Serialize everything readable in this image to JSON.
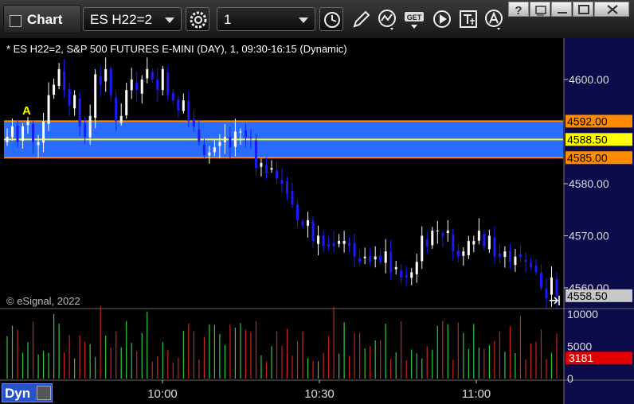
{
  "window": {
    "tab_label": "Chart",
    "symbol": "ES H22=2",
    "interval": "1",
    "toolbar_icons": [
      "settings-icon",
      "clock-icon",
      "pencil-icon",
      "indicator-icon",
      "get-icon",
      "play-icon",
      "text-icon",
      "alert-icon"
    ],
    "window_controls": [
      "help-icon",
      "restore-icon",
      "maximize-icon",
      "close-icon"
    ]
  },
  "chart_title": "* ES H22=2, S&P 500 FUTURES E-MINI (DAY), 1, 09:30-16:15 (Dynamic)",
  "copyright": "© eSignal, 2022",
  "marker_label": "A",
  "price_axis": {
    "labels": [
      "4600.00",
      "4580.00",
      "4570.00",
      "4560.00"
    ],
    "tags": [
      {
        "text": "4592.00",
        "price": 4592.0,
        "bg": "#ff8c00",
        "fg": "#000000"
      },
      {
        "text": "4588.50",
        "price": 4588.5,
        "bg": "#ffff00",
        "fg": "#000000"
      },
      {
        "text": "4585.00",
        "price": 4585.0,
        "bg": "#ff8c00",
        "fg": "#000000"
      },
      {
        "text": "4558.50",
        "price": 4558.5,
        "bg": "#c8c8c8",
        "fg": "#000000"
      }
    ]
  },
  "volume_axis": {
    "labels": [
      "10000",
      "5000",
      "0"
    ],
    "tag": {
      "text": "3181",
      "value": 3181,
      "bg": "#e00000",
      "fg": "#ffffff"
    }
  },
  "time_axis": {
    "labels": [
      "10:00",
      "10:30",
      "11:00"
    ]
  },
  "bottom_bar": {
    "label": "Dyn"
  },
  "colors": {
    "background": "#000000",
    "band": "#2a6cff",
    "band_line": "#ff8c00",
    "mid_line": "#ffff00",
    "bull": "#ffffff",
    "bear": "#1a1aff",
    "vol_up": "#2ecc40",
    "vol_down": "#cc2222",
    "axis_bg": "#0c0c4a"
  },
  "chart_data": {
    "type": "candlestick",
    "price_range": [
      4556.5,
      4604.5
    ],
    "volume_range": [
      0,
      12000
    ],
    "band": {
      "upper": 4592.0,
      "mid": 4588.5,
      "lower": 4585.0
    },
    "time_labels": [
      {
        "text": "10:00",
        "bar": 30
      },
      {
        "text": "10:30",
        "bar": 60
      },
      {
        "text": "11:00",
        "bar": 90
      }
    ],
    "bars_count": 107,
    "closes": [
      4589.0,
      4591.0,
      4588.0,
      4591.0,
      4592.0,
      4588.0,
      4588.0,
      4592.0,
      4597.0,
      4599.0,
      4602.0,
      4598.0,
      4595.0,
      4597.0,
      4591.0,
      4589.0,
      4593.0,
      4601.0,
      4599.0,
      4602.0,
      4597.0,
      4592.0,
      4593.0,
      4598.0,
      4600.0,
      4598.0,
      4600.0,
      4602.0,
      4600.0,
      4598.0,
      4602.0,
      4597.0,
      4596.0,
      4594.0,
      4596.0,
      4592.0,
      4591.0,
      4588.0,
      4585.5,
      4586.0,
      4587.0,
      4588.0,
      4589.0,
      4587.0,
      4590.0,
      4590.0,
      4589.0,
      4589.0,
      4583.0,
      4584.0,
      4582.0,
      4583.0,
      4581.0,
      4580.0,
      4578.0,
      4576.0,
      4573.0,
      4572.0,
      4573.0,
      4569.0,
      4570.0,
      4568.0,
      4568.0,
      4568.0,
      4569.0,
      4569.0,
      4568.0,
      4566.0,
      4565.0,
      4566.0,
      4565.0,
      4566.0,
      4565.0,
      4567.0,
      4563.0,
      4564.0,
      4562.0,
      4562.0,
      4563.0,
      4565.0,
      4570.0,
      4568.0,
      4571.0,
      4571.0,
      4570.0,
      4571.0,
      4567.0,
      4566.0,
      4567.0,
      4569.0,
      4569.0,
      4571.0,
      4568.0,
      4570.0,
      4566.0,
      4566.0,
      4567.0,
      4565.0,
      4566.0,
      4566.0,
      4565.0,
      4564.0,
      4563.0,
      4560.0,
      4558.0,
      4562.0,
      4558.5
    ]
  }
}
